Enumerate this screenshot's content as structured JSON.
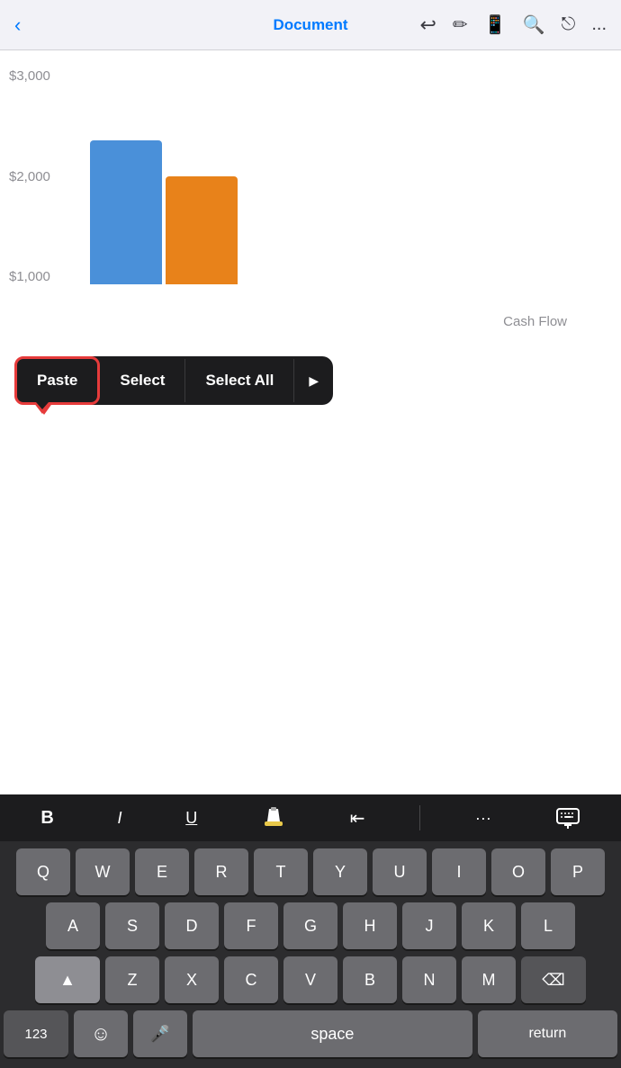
{
  "nav": {
    "title": "Document",
    "back_label": "‹",
    "undo_icon": "undo",
    "pen_icon": "pen",
    "device_icon": "phone",
    "search_icon": "search",
    "share_icon": "share",
    "more_icon": "..."
  },
  "chart": {
    "y_labels": [
      "$3,000",
      "$2,000",
      "$1,000"
    ],
    "bar_label": "Cash Flow",
    "bars": [
      {
        "color": "blue",
        "height": 160
      },
      {
        "color": "orange",
        "height": 120
      }
    ]
  },
  "context_menu": {
    "paste_label": "Paste",
    "select_label": "Select",
    "select_all_label": "Select All",
    "more_icon": "▶"
  },
  "keyboard_toolbar": {
    "bold_label": "B",
    "italic_label": "I",
    "underline_label": "U",
    "highlight_label": "✏",
    "indent_label": "⇥",
    "more_label": "···",
    "dismiss_label": "⌨"
  },
  "keyboard": {
    "row1": [
      "Q",
      "W",
      "E",
      "R",
      "T",
      "Y",
      "U",
      "I",
      "O",
      "P"
    ],
    "row2": [
      "A",
      "S",
      "D",
      "F",
      "G",
      "H",
      "J",
      "K",
      "L"
    ],
    "row3": [
      "Z",
      "X",
      "C",
      "V",
      "B",
      "N",
      "M"
    ],
    "num_label": "123",
    "emoji_label": "☺",
    "mic_label": "🎤",
    "space_label": "space",
    "return_label": "return",
    "delete_label": "⌫",
    "shift_label": "▲"
  }
}
